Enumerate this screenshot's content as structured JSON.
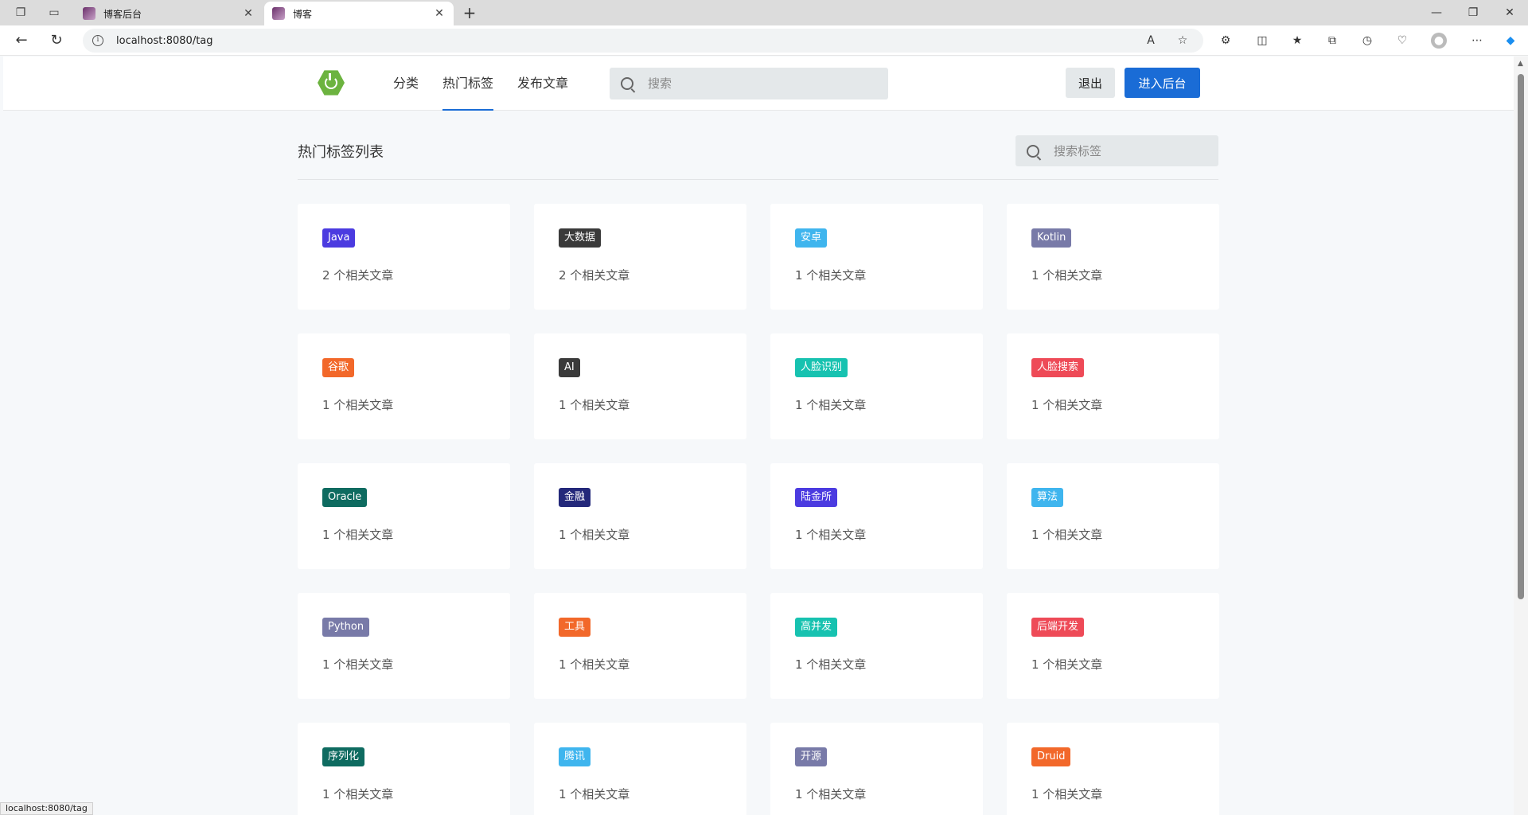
{
  "browser": {
    "tabs": [
      {
        "title": "博客后台",
        "active": false
      },
      {
        "title": "博客",
        "active": true
      }
    ],
    "url": "localhost:8080/tag",
    "status_url": "localhost:8080/tag"
  },
  "header": {
    "nav": [
      {
        "label": "分类",
        "active": false
      },
      {
        "label": "热门标签",
        "active": true
      },
      {
        "label": "发布文章",
        "active": false
      }
    ],
    "search_placeholder": "搜索",
    "logout_label": "退出",
    "admin_label": "进入后台",
    "accent_color": "#1a6cd6"
  },
  "main": {
    "title": "热门标签列表",
    "tag_search_placeholder": "搜索标签",
    "tags": [
      {
        "name": "Java",
        "count": "2 个相关文章",
        "color": "#4b3be0"
      },
      {
        "name": "大数据",
        "count": "2 个相关文章",
        "color": "#3a3a3a"
      },
      {
        "name": "安卓",
        "count": "1 个相关文章",
        "color": "#3fb5ee"
      },
      {
        "name": "Kotlin",
        "count": "1 个相关文章",
        "color": "#787aa8"
      },
      {
        "name": "谷歌",
        "count": "1 个相关文章",
        "color": "#f2682a"
      },
      {
        "name": "AI",
        "count": "1 个相关文章",
        "color": "#3a3a3a"
      },
      {
        "name": "人脸识别",
        "count": "1 个相关文章",
        "color": "#17c2b0"
      },
      {
        "name": "人脸搜索",
        "count": "1 个相关文章",
        "color": "#ee4a57"
      },
      {
        "name": "Oracle",
        "count": "1 个相关文章",
        "color": "#0e6b60"
      },
      {
        "name": "金融",
        "count": "1 个相关文章",
        "color": "#23287a"
      },
      {
        "name": "陆金所",
        "count": "1 个相关文章",
        "color": "#4b3be0"
      },
      {
        "name": "算法",
        "count": "1 个相关文章",
        "color": "#3fb5ee"
      },
      {
        "name": "Python",
        "count": "1 个相关文章",
        "color": "#787aa8"
      },
      {
        "name": "工具",
        "count": "1 个相关文章",
        "color": "#f2682a"
      },
      {
        "name": "高并发",
        "count": "1 个相关文章",
        "color": "#17c2b0"
      },
      {
        "name": "后端开发",
        "count": "1 个相关文章",
        "color": "#ee4a57"
      },
      {
        "name": "序列化",
        "count": "1 个相关文章",
        "color": "#0e6b60"
      },
      {
        "name": "腾讯",
        "count": "1 个相关文章",
        "color": "#3fb5ee"
      },
      {
        "name": "开源",
        "count": "1 个相关文章",
        "color": "#787aa8"
      },
      {
        "name": "Druid",
        "count": "1 个相关文章",
        "color": "#f2682a"
      }
    ]
  }
}
